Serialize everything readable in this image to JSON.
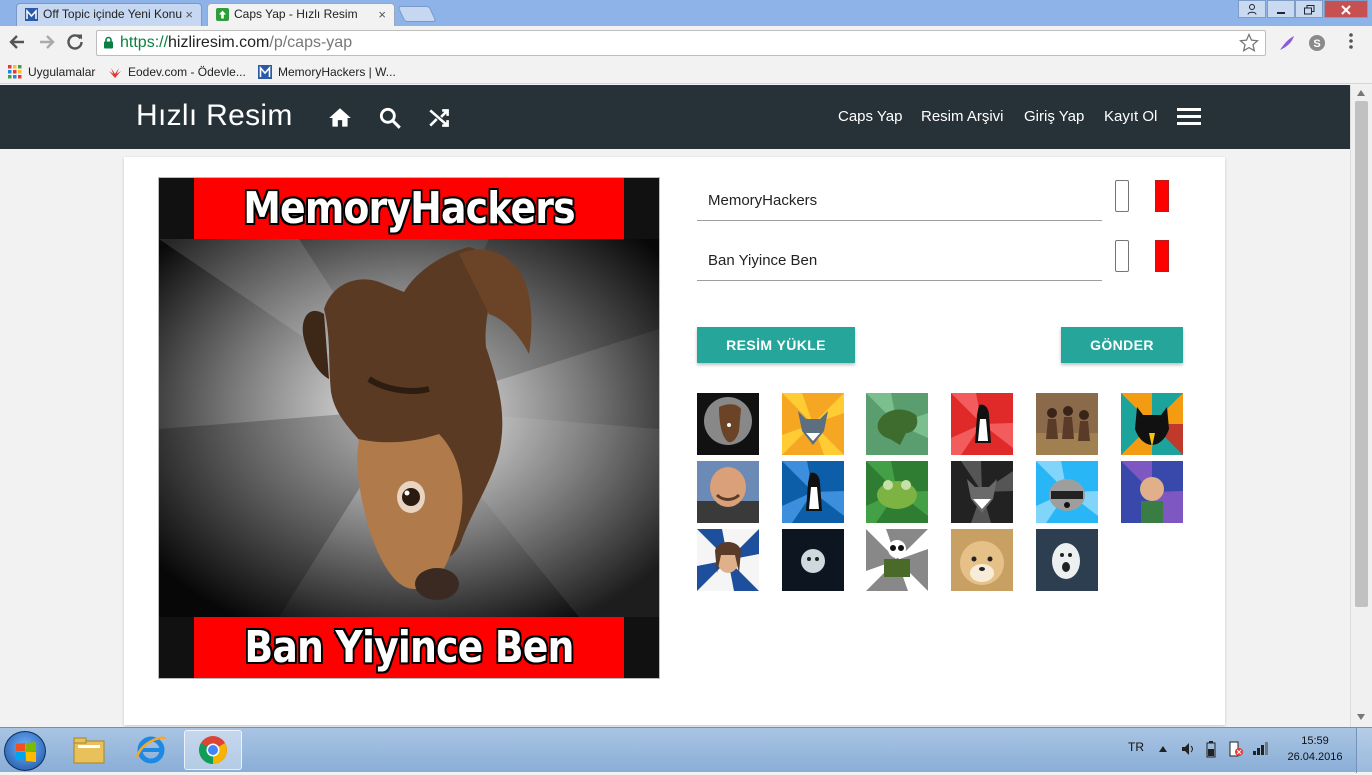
{
  "browser": {
    "tabs": [
      {
        "title": "Off Topic içinde Yeni Konu",
        "active": false
      },
      {
        "title": "Caps Yap - Hızlı Resim",
        "active": true
      }
    ],
    "tab_close": "×",
    "url_scheme": "https://",
    "url_host": "hizliresim.com",
    "url_path": "/p/caps-yap",
    "bookmarks": [
      "Uygulamalar",
      "Eodev.com - Ödevle...",
      "MemoryHackers | W..."
    ]
  },
  "site": {
    "brand": "Hızlı Resim",
    "header_icons": [
      "home-icon",
      "search-icon",
      "shuffle-icon"
    ],
    "nav": [
      "Caps Yap",
      "Resim Arşivi",
      "Giriş Yap",
      "Kayıt Ol"
    ]
  },
  "editor": {
    "top_text": "MemoryHackers",
    "bottom_text": "Ban Yiyince Ben",
    "top_text_color": "#ffffff",
    "top_bg_color": "#ff0000",
    "bottom_text_color": "#ffffff",
    "bottom_bg_color": "#ff0000",
    "upload_label": "RESİM YÜKLE",
    "send_label": "GÖNDER",
    "accent": "#26a69a"
  },
  "templates": [
    "depression-dog",
    "courage-wolf",
    "philosoraptor",
    "socially-awkward-penguin",
    "dancing-kids",
    "business-cat",
    "good-guy-greg",
    "socially-awesome-penguin",
    "foul-bachelor-frog",
    "insanity-wolf",
    "confession-raccoon",
    "success-kid",
    "overly-attached-girlfriend",
    "forever-alone",
    "panda",
    "doge",
    "y-u-no-guy"
  ],
  "taskbar": {
    "lang": "TR",
    "time": "15:59",
    "date": "26.04.2016"
  }
}
